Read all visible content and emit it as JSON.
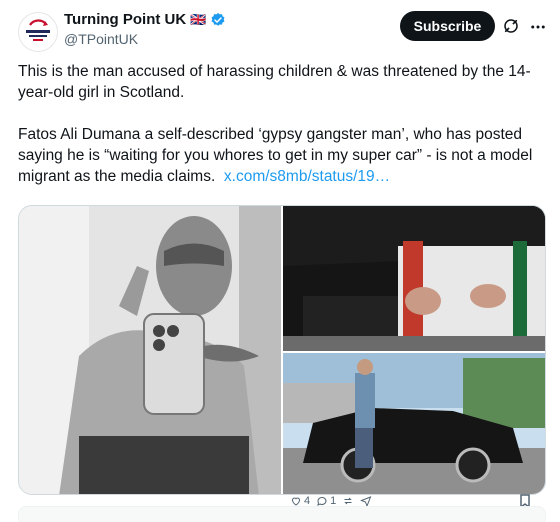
{
  "account": {
    "display_name": "Turning Point UK",
    "flag": "🇬🇧",
    "handle": "@TPointUK",
    "avatar_text": "TURNING POINT UK"
  },
  "header": {
    "subscribe_label": "Subscribe"
  },
  "tweet": {
    "paragraph_1": "This is the man accused of harassing children & was threatened by the 14-year-old girl in Scotland.",
    "paragraph_2": "Fatos Ali Dumana a self-described ‘gypsy gangster man’, who has posted saying he is “waiting for you whores to get in my super car” - is not a model migrant as the media claims.",
    "link": "x.com/s8mb/status/19…"
  },
  "media": {
    "photo_1": "selfie-photo",
    "photo_2": "seated-people-photo",
    "photo_3": "car-photo"
  },
  "inner_actions": {
    "replies": "4",
    "retweets": "1"
  },
  "colors": {
    "text": "#0f1419",
    "secondary": "#536471",
    "link": "#1d9bf0",
    "verified": "#1d9bf0",
    "subscribe_bg": "#0f1419",
    "brand_red": "#c8102e"
  }
}
